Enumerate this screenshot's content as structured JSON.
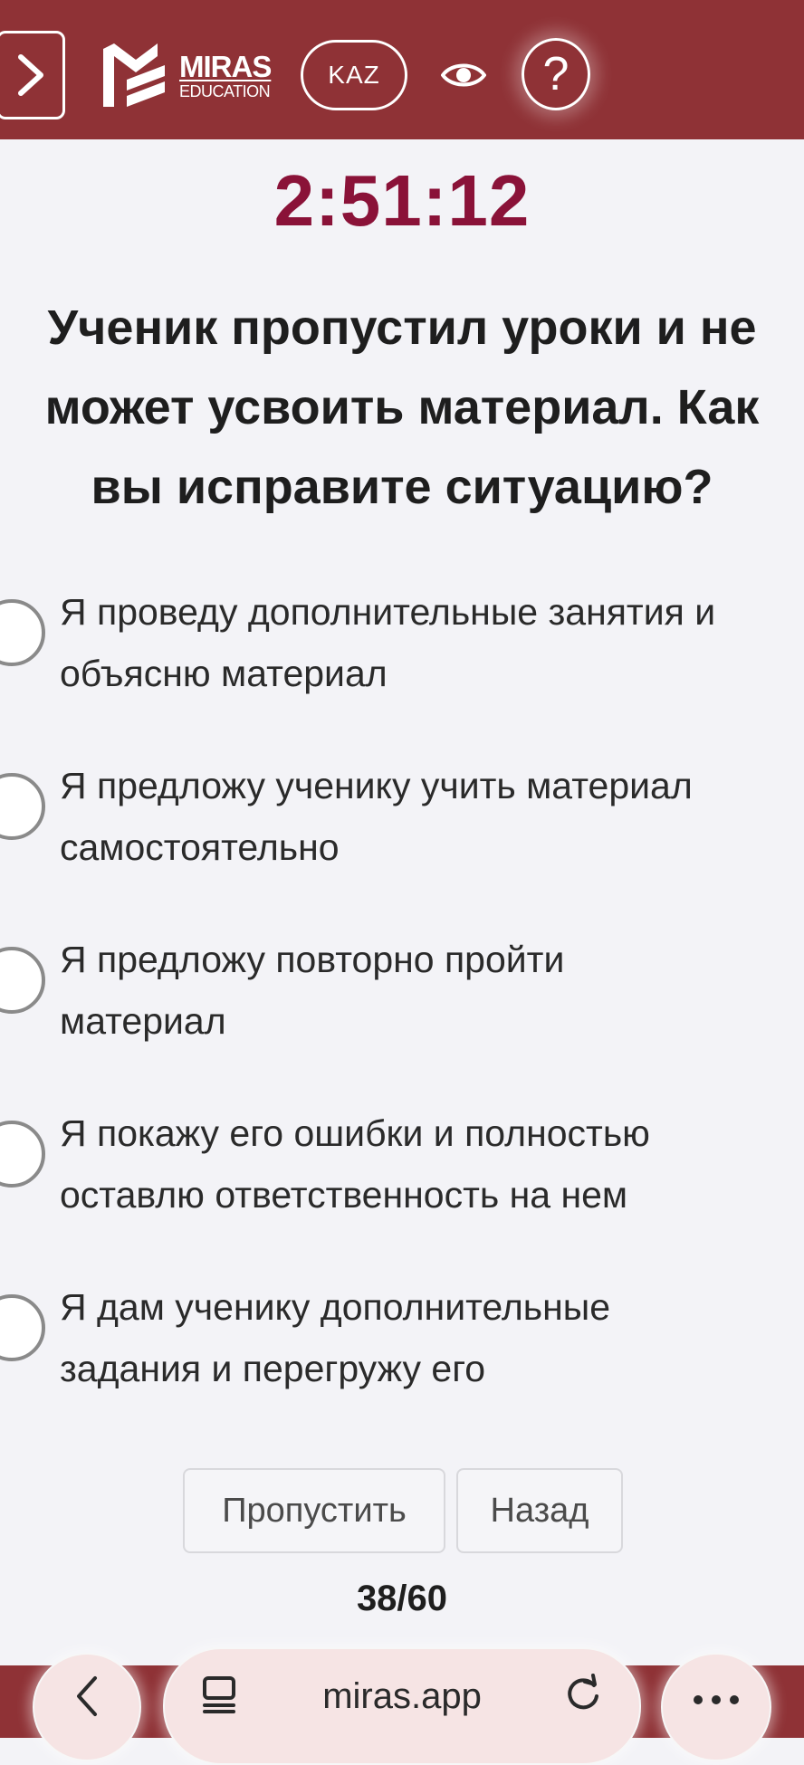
{
  "header": {
    "brand_title": "MIRAS",
    "brand_subtitle": "EDUCATION",
    "language": "KAZ",
    "help": "?",
    "background": "#8f3236"
  },
  "timer": "2:51:12",
  "question": {
    "lines": [
      "Ученик пропустил уроки и не",
      "может усвоить материал. Как",
      "вы исправите ситуацию?"
    ]
  },
  "options": [
    {
      "lines": [
        "Я проведу дополнительные занятия и",
        "объясню материал"
      ],
      "selected": false
    },
    {
      "lines": [
        "Я предложу ученику учить материал",
        "самостоятельно"
      ],
      "selected": false
    },
    {
      "lines": [
        "Я предложу повторно пройти",
        "материал"
      ],
      "selected": false
    },
    {
      "lines": [
        "Я покажу его ошибки и полностью",
        "оставлю ответственность на нем"
      ],
      "selected": false
    },
    {
      "lines": [
        "Я дам ученику дополнительные",
        "задания и перегружу его"
      ],
      "selected": false
    }
  ],
  "actions": {
    "skip_label": "Пропустить",
    "back_label": "Назад"
  },
  "progress": "38/60",
  "browser": {
    "url": "miras.app",
    "icons": [
      "chevron-left-icon",
      "tabs-icon",
      "reload-icon",
      "more-icon"
    ]
  },
  "colors": {
    "accent": "#8a1238",
    "header": "#8f3236"
  }
}
